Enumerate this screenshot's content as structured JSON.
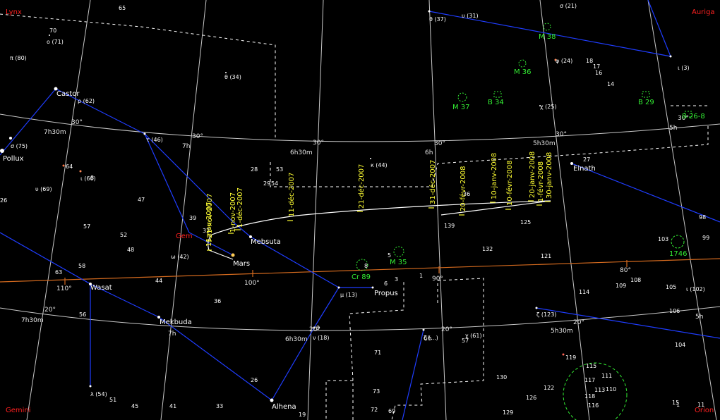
{
  "colors": {
    "background": "#000000",
    "grid": "#c8c8c8",
    "ecliptic": "#d2691e",
    "constellation_lines": "#1f3dff",
    "boundaries": "#ffffff",
    "dates": "#ffff33",
    "deep_sky": "#33ee33",
    "constellation_names": "#ff2020"
  },
  "constellation_names": [
    "Lynx",
    "Auriga",
    "Gem",
    "Gemini",
    "Orion"
  ],
  "grid_labels": {
    "declination": [
      "30°",
      "30°",
      "30°",
      "30°",
      "30°",
      "30°",
      "20°",
      "20°",
      "20°",
      "20°"
    ],
    "right_ascension": [
      "7h30m",
      "7h",
      "6h30m",
      "6h",
      "5h30m",
      "5h",
      "7h30m",
      "7h",
      "6h30m",
      "6h",
      "5h30m",
      "5h"
    ],
    "ecliptic": [
      "110°",
      "100°",
      "90°",
      "80°"
    ]
  },
  "named_stars": [
    "Castor",
    "Pollux",
    "Mebsuta",
    "Mars",
    "Wasat",
    "Mekbuda",
    "Propus",
    "Elnath",
    "Alhena"
  ],
  "greek_stars": [
    "ο (71)",
    "π (80)",
    "θ (34)",
    "ρ (62)",
    "σ (75)",
    "τ (46)",
    "ι (60)",
    "υ (69)",
    "ω (42)",
    "κ (44)",
    "μ (13)",
    "ν (18)",
    "λ (54)",
    "ζ (123)",
    "χ (25)",
    "φ (24)",
    "ι (3)",
    "θ (37)",
    "υ (31)",
    "σ (21)",
    "ι (102)",
    "χ (61)",
    "ζ (...)"
  ],
  "numbered_stars": [
    "65",
    "70",
    "26",
    "64",
    "28",
    "53",
    "29",
    "54",
    "47",
    "57",
    "52",
    "48",
    "44",
    "36",
    "56",
    "58",
    "51",
    "45",
    "41",
    "33",
    "26",
    "19",
    "72",
    "69",
    "71",
    "6",
    "3",
    "1",
    "5",
    "8",
    "36",
    "139",
    "125",
    "132",
    "121",
    "114",
    "109",
    "108",
    "105",
    "106",
    "104",
    "119",
    "130",
    "122",
    "126",
    "129",
    "117",
    "113",
    "110",
    "111",
    "118",
    "115",
    "116",
    "103",
    "99",
    "98",
    "27",
    "17",
    "16",
    "14",
    "18",
    "57",
    "63",
    "39",
    "15",
    "11",
    "8",
    "9",
    "32",
    "73",
    "1"
  ],
  "deep_sky_objects": [
    "M 38",
    "M 36",
    "M 37",
    "B 34",
    "B 29",
    "B 26-8",
    "M 35",
    "Cr 89",
    "1746"
  ],
  "mars_dates": [
    "11-nov-2007",
    "21-nov-2007",
    "1-nov-2007",
    "1-déc-2007",
    "11-déc-2007",
    "21-déc-2007",
    "31-déc-2007",
    "20-févr-2008",
    "10-janv-2008",
    "10-févr-2008",
    "20-janv-2008",
    "1-févr-2008",
    "30-janv-2008"
  ]
}
